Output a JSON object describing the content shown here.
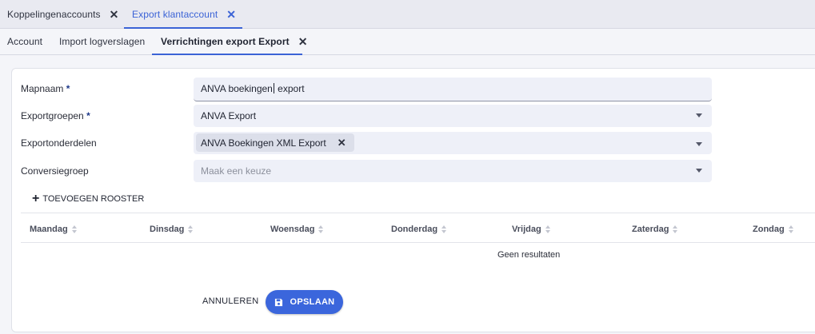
{
  "top_tabs": [
    {
      "label": "Koppelingenaccounts"
    },
    {
      "label": "Export klantaccount"
    }
  ],
  "sub_tabs": [
    {
      "label": "Account"
    },
    {
      "label": "Import logverslagen"
    },
    {
      "label": "Verrichtingen export Export"
    }
  ],
  "form": {
    "mapnaam": {
      "label": "Mapnaam",
      "required": "*",
      "value_before_cursor": "ANVA boekingen",
      "value_after_cursor": " export"
    },
    "exportgroepen": {
      "label": "Exportgroepen",
      "required": "*",
      "value": "ANVA Export"
    },
    "exportonderdelen": {
      "label": "Exportonderdelen",
      "chip": "ANVA Boekingen XML Export"
    },
    "conversiegroep": {
      "label": "Conversiegroep",
      "placeholder": "Maak een keuze"
    }
  },
  "add_schedule_button": "TOEVOEGEN ROOSTER",
  "table": {
    "columns": [
      "Maandag",
      "Dinsdag",
      "Woensdag",
      "Donderdag",
      "Vrijdag",
      "Zaterdag",
      "Zondag"
    ],
    "empty_text": "Geen resultaten"
  },
  "actions": {
    "cancel": "ANNULEREN",
    "save": "OPSLAAN"
  },
  "colors": {
    "accent": "#3b63d6",
    "save_button": "#3b66dc",
    "field_bg": "#eef0f8"
  }
}
